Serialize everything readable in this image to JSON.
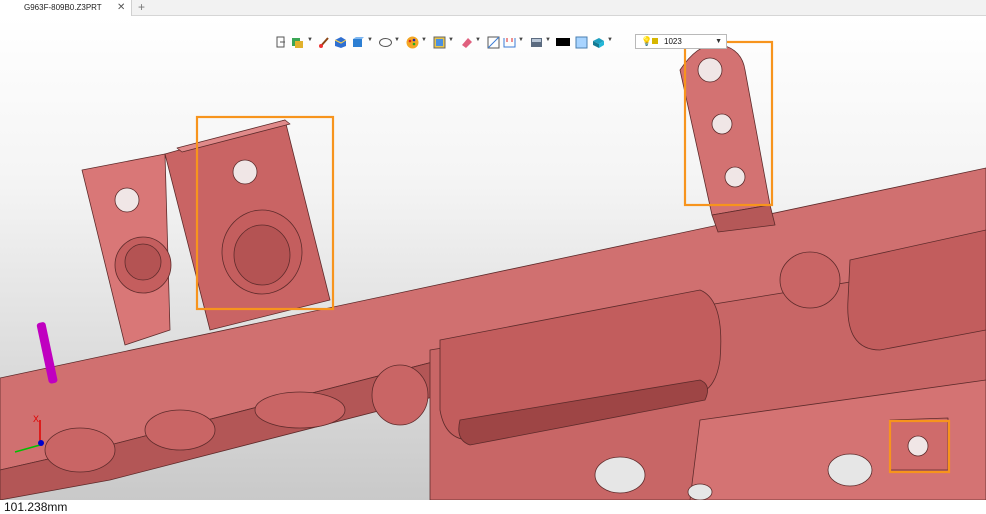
{
  "tab": {
    "title": "G963F-809B0.Z3PRT",
    "close_glyph": "✕",
    "new_glyph": "+"
  },
  "toolbar": {
    "icons": [
      "exit-icon",
      "layer-filter-icon",
      "paint-brush-icon",
      "shaded-view-icon",
      "box-view-icon",
      "ellipse-view-icon",
      "color-palette-icon",
      "render-mode-icon",
      "eraser-icon",
      "section-view-icon",
      "measure-icon",
      "display-mode-icon",
      "black-color-swatch",
      "plane-icon",
      "solid-color-icon",
      "layer-bulb-icon"
    ],
    "layer_value": "1023"
  },
  "status": {
    "distance": "101.238mm"
  },
  "colors": {
    "model": "#cf6b6b",
    "model_edge": "#5e2b2b",
    "highlight": "#f7941d",
    "triad_pin": "#c000c0"
  }
}
